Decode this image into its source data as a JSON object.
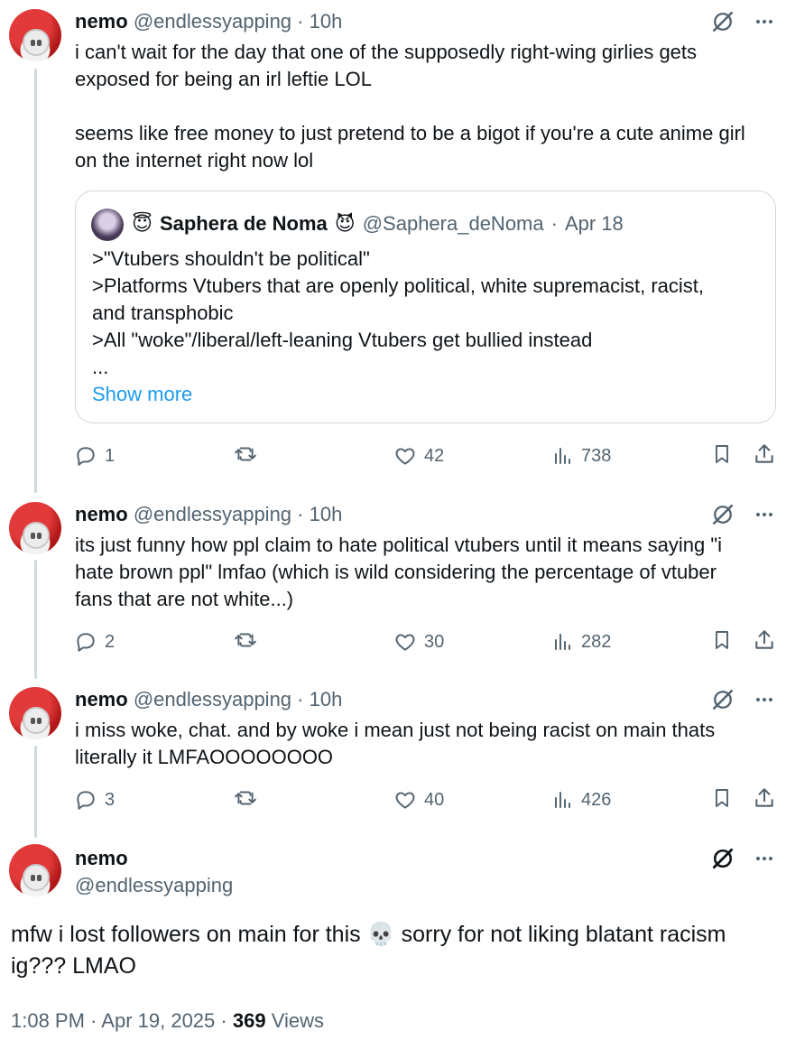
{
  "tweets": [
    {
      "name": "nemo",
      "handle": "@endlessyapping",
      "sep": "·",
      "time": "10h",
      "text": "i can't wait for the day that one of the supposedly right-wing girlies gets\nexposed for being an irl leftie LOL\n\nseems like free money to just pretend to be a bigot if you're a cute anime girl\non the internet right now lol",
      "quote": {
        "emoji_before": "😇",
        "name": "Saphera de Noma",
        "emoji_after": "😈",
        "handle": "@Saphera_deNoma",
        "sep": "·",
        "date": "Apr 18",
        "text": ">\"Vtubers shouldn't be political\"\n>Platforms Vtubers that are openly political, white supremacist, racist,\nand transphobic\n>All \"woke\"/liberal/left-leaning Vtubers get bullied instead\n...",
        "show_more": "Show more"
      },
      "replies": "1",
      "retweets": "",
      "likes": "42",
      "views": "738"
    },
    {
      "name": "nemo",
      "handle": "@endlessyapping",
      "sep": "·",
      "time": "10h",
      "text": "its just funny how ppl claim to hate political vtubers until it means saying \"i\nhate brown ppl\" lmfao (which is wild considering the percentage of vtuber\nfans that are not white...)",
      "replies": "2",
      "retweets": "",
      "likes": "30",
      "views": "282"
    },
    {
      "name": "nemo",
      "handle": "@endlessyapping",
      "sep": "·",
      "time": "10h",
      "text": "i miss woke, chat. and by woke i mean just not being racist on main thats\nliterally it LMFAOOOOOOOO",
      "replies": "3",
      "retweets": "",
      "likes": "40",
      "views": "426"
    }
  ],
  "main": {
    "name": "nemo",
    "handle": "@endlessyapping",
    "text": "mfw i lost followers on main for this 💀 sorry for not liking blatant racism\nig??? LMAO",
    "time": "1:08 PM",
    "sep1": "·",
    "date": "Apr 19, 2025",
    "sep2": "·",
    "views_count": "369",
    "views_label": "Views"
  },
  "colors": {
    "text": "#0f1419",
    "secondary": "#536471",
    "link": "#1d9bf0",
    "border": "#cfd9de"
  },
  "icons": [
    "grok-icon",
    "more-icon",
    "reply-icon",
    "retweet-icon",
    "like-icon",
    "views-icon",
    "bookmark-icon",
    "share-icon"
  ]
}
